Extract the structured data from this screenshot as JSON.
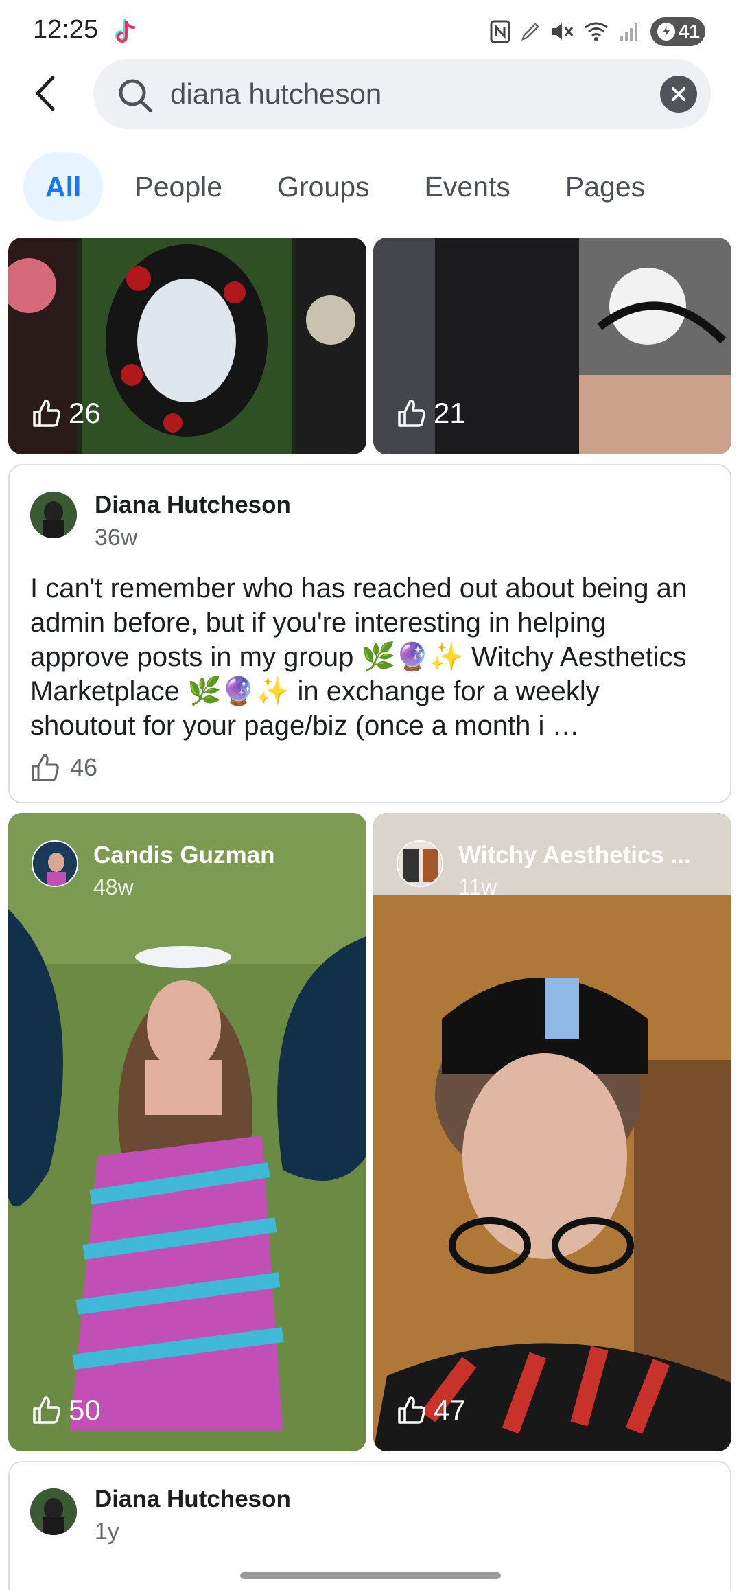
{
  "status_bar": {
    "time": "12:25",
    "battery": "41",
    "icons": [
      "tiktok-icon",
      "nfc-icon",
      "edit-icon",
      "mute-icon",
      "wifi-icon",
      "signal-icon",
      "battery-icon"
    ]
  },
  "search": {
    "query": "diana hutcheson",
    "icons": [
      "back-arrow-icon",
      "search-icon",
      "clear-icon"
    ]
  },
  "tabs": [
    {
      "label": "All"
    },
    {
      "label": "People"
    },
    {
      "label": "Groups"
    },
    {
      "label": "Events"
    },
    {
      "label": "Pages"
    }
  ],
  "results": {
    "top_photos": [
      {
        "likes": "26"
      },
      {
        "likes": "21"
      }
    ],
    "post_1": {
      "author": "Diana Hutcheson",
      "time": "36w",
      "text": "I can't remember who has reached out about being an admin before, but if you're interesting in helping approve posts in my group 🌿🔮✨ Witchy Aesthetics Marketplace 🌿🔮✨ in exchange for a weekly shoutout for your page/biz (once a month i …",
      "likes": "46"
    },
    "photo_posts": [
      {
        "author": "Candis Guzman",
        "time": "48w",
        "likes": "50"
      },
      {
        "author": "Witchy Aesthetics ...",
        "time": "11w",
        "likes": "47"
      }
    ],
    "post_2": {
      "author": "Diana Hutcheson",
      "time": "1y"
    }
  },
  "colors": {
    "accent": "#1877f2",
    "active_tab_bg": "#e7f3ff",
    "search_bg": "#eef0f3"
  }
}
